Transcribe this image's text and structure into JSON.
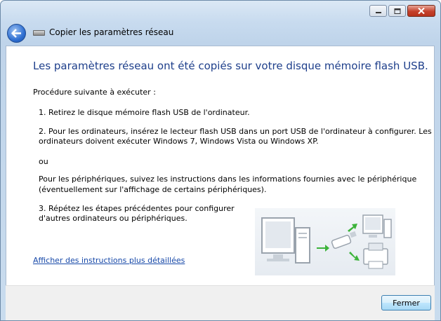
{
  "window": {
    "title": "Copier les paramètres réseau"
  },
  "content": {
    "heading": "Les paramètres réseau ont été copiés sur votre disque mémoire flash USB.",
    "procedure_label": "Procédure suivante à exécuter :",
    "step1": "1. Retirez le disque mémoire flash USB de l'ordinateur.",
    "step2_line1": "2. Pour les ordinateurs, insérez le lecteur flash USB dans un port USB de l'ordinateur à configurer. Les",
    "step2_line2": "ordinateurs doivent exécuter Windows 7, Windows Vista ou Windows XP.",
    "or_label": "ou",
    "devices_line1": "Pour les périphériques, suivez les instructions dans les informations fournies avec le périphérique",
    "devices_line2": "(éventuellement sur l'affichage de certains périphériques).",
    "step3_line1": "3. Répétez les étapes précédentes pour configurer",
    "step3_line2": "d'autres ordinateurs ou périphériques.",
    "details_link": "Afficher des instructions plus détaillées"
  },
  "footer": {
    "close_label": "Fermer"
  },
  "colors": {
    "heading": "#1e3f8b",
    "link": "#1648a8",
    "arrow": "#3cb33a"
  },
  "icons": [
    "minimize-icon",
    "maximize-icon",
    "close-icon",
    "back-arrow-icon",
    "network-wizard-icon"
  ]
}
